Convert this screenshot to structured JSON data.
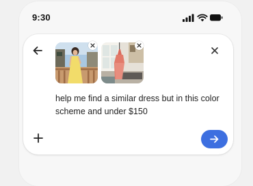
{
  "status_bar": {
    "time": "9:30",
    "icons": [
      "signal-icon",
      "wifi-icon",
      "battery-icon"
    ]
  },
  "composer": {
    "back_icon": "back-arrow-icon",
    "close_icon": "close-icon",
    "attachments": [
      {
        "name": "attachment-photo-yellow-dress",
        "remove_icon": "remove-attachment-icon"
      },
      {
        "name": "attachment-photo-pink-dress",
        "remove_icon": "remove-attachment-icon"
      }
    ],
    "prompt_text": "help me find a similar dress but in this color scheme and under $150",
    "add_icon": "plus-icon",
    "send_icon": "send-arrow-icon"
  },
  "colors": {
    "accent": "#3d6fe0",
    "card_background": "#ffffff",
    "page_background": "#f1f1f1",
    "text": "#1f1f1f"
  }
}
